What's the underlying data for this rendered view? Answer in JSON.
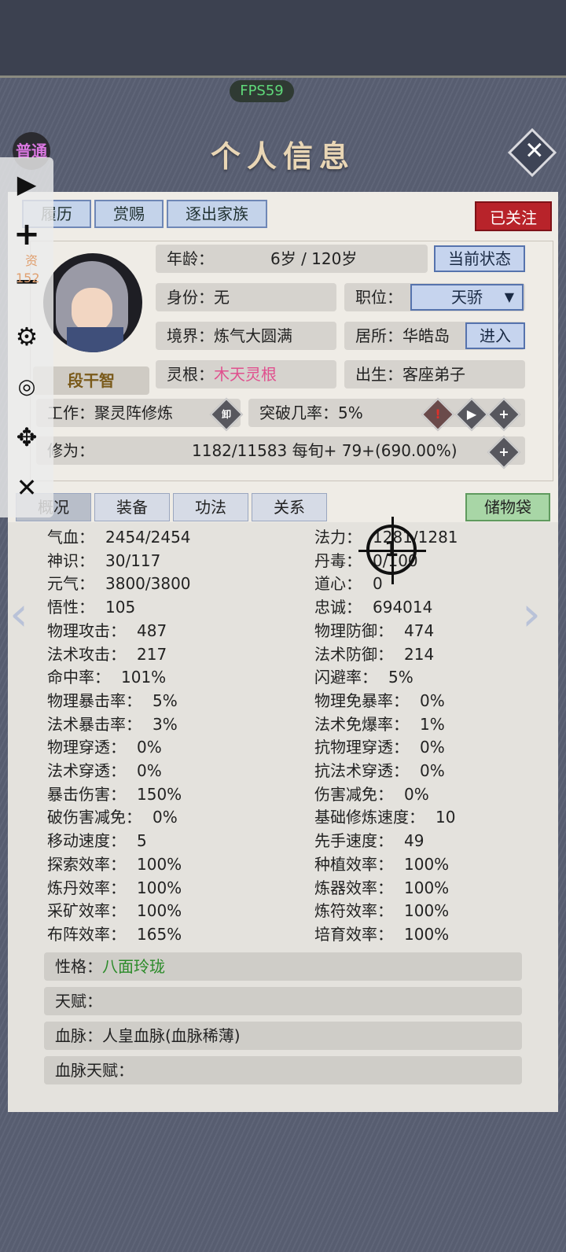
{
  "status": {
    "fps": "FPS59"
  },
  "header": {
    "title": "个人信息"
  },
  "mode_badge": "普通",
  "top_tabs": [
    "履历",
    "赏赐",
    "逐出家族"
  ],
  "follow_button": "已关注",
  "profile": {
    "name": "段干智",
    "age_label": "年龄：",
    "age_value": "6岁 / 120岁",
    "current_status_button": "当前状态",
    "identity_label": "身份：",
    "identity_value": "无",
    "position_label": "职位：",
    "position_value": "天骄",
    "realm_label": "境界：",
    "realm_value": "炼气大圆满",
    "residence_label": "居所：",
    "residence_value": "华皓岛",
    "enter_button": "进入",
    "root_label": "灵根：",
    "root_value": "木天灵根",
    "birth_label": "出生：",
    "birth_value": "客座弟子",
    "work_label": "工作：",
    "work_value": "聚灵阵修炼",
    "unload_icon_label": "卸",
    "breakthrough_label": "突破几率：",
    "breakthrough_value": "5%",
    "cultivation_label": "修为：",
    "cultivation_value": "1182/11583  每旬+  79+(690.00%)"
  },
  "mid_tabs": [
    "概况",
    "装备",
    "功法",
    "关系"
  ],
  "storage_button": "储物袋",
  "stats_left": [
    {
      "label": "气血：",
      "value": "2454/2454"
    },
    {
      "label": "神识：",
      "value": "30/117"
    },
    {
      "label": "元气：",
      "value": "3800/3800"
    },
    {
      "label": "悟性：",
      "value": "105"
    },
    {
      "label": "物理攻击：",
      "value": "487"
    },
    {
      "label": "法术攻击：",
      "value": "217"
    },
    {
      "label": "命中率：",
      "value": "101%"
    },
    {
      "label": "物理暴击率：",
      "value": "5%"
    },
    {
      "label": "法术暴击率：",
      "value": "3%"
    },
    {
      "label": "物理穿透：",
      "value": "0%"
    },
    {
      "label": "法术穿透：",
      "value": "0%"
    },
    {
      "label": "暴击伤害：",
      "value": "150%"
    },
    {
      "label": "破伤害减免：",
      "value": "0%"
    },
    {
      "label": "移动速度：",
      "value": "5"
    },
    {
      "label": "探索效率：",
      "value": "100%"
    },
    {
      "label": "炼丹效率：",
      "value": "100%"
    },
    {
      "label": "采矿效率：",
      "value": "100%"
    },
    {
      "label": "布阵效率：",
      "value": "165%"
    }
  ],
  "stats_right": [
    {
      "label": "法力：",
      "value": "1281/1281"
    },
    {
      "label": "丹毒：",
      "value": "0/100"
    },
    {
      "label": "道心：",
      "value": "0"
    },
    {
      "label": "忠诚：",
      "value": "694014"
    },
    {
      "label": "物理防御：",
      "value": "474"
    },
    {
      "label": "法术防御：",
      "value": "214"
    },
    {
      "label": "闪避率：",
      "value": "5%"
    },
    {
      "label": "物理免暴率：",
      "value": "0%"
    },
    {
      "label": "法术免爆率：",
      "value": "1%"
    },
    {
      "label": "抗物理穿透：",
      "value": "0%"
    },
    {
      "label": "抗法术穿透：",
      "value": "0%"
    },
    {
      "label": "伤害减免：",
      "value": "0%"
    },
    {
      "label": "基础修炼速度：",
      "value": "10"
    },
    {
      "label": "先手速度：",
      "value": "49"
    },
    {
      "label": "种植效率：",
      "value": "100%"
    },
    {
      "label": "炼器效率：",
      "value": "100%"
    },
    {
      "label": "炼符效率：",
      "value": "100%"
    },
    {
      "label": "培育效率：",
      "value": "100%"
    }
  ],
  "bars": {
    "personality_label": "性格：",
    "personality_value": "八面玲珑",
    "talent_label": "天赋：",
    "bloodline_label": "血脉：",
    "bloodline_value": "人皇血脉(血脉稀薄)",
    "bloodline_talent_label": "血脉天赋："
  },
  "overlay": {
    "target_number": "1",
    "side_text_1": "资",
    "side_text_2": "152"
  },
  "icons": [
    "play-icon",
    "plus-icon",
    "minus-icon",
    "gear-icon",
    "eye-off-icon",
    "move-icon",
    "close-icon",
    "left-arrow-icon",
    "right-arrow-icon"
  ]
}
